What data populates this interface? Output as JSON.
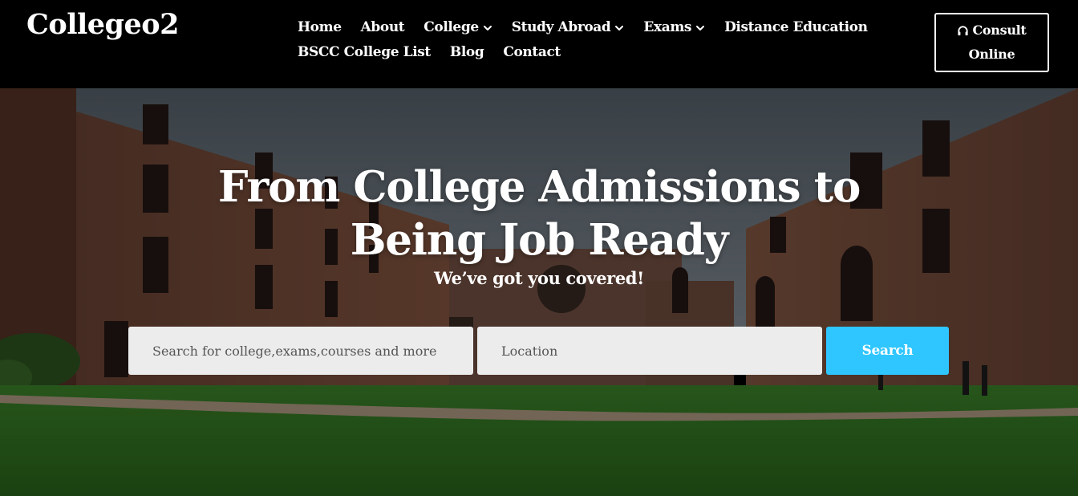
{
  "header": {
    "logo": "Collegeo2",
    "nav_row1": [
      {
        "label": "Home",
        "dropdown": false
      },
      {
        "label": "About",
        "dropdown": false
      },
      {
        "label": "College",
        "dropdown": true
      },
      {
        "label": "Study Abroad",
        "dropdown": true
      },
      {
        "label": "Exams",
        "dropdown": true
      },
      {
        "label": "Distance Education",
        "dropdown": false
      }
    ],
    "nav_row2": [
      {
        "label": "BSCC College List",
        "dropdown": false
      },
      {
        "label": "Blog",
        "dropdown": false
      },
      {
        "label": "Contact",
        "dropdown": false
      }
    ],
    "consult": {
      "line1": "Consult",
      "line2": "Online",
      "icon": "headset-icon"
    }
  },
  "hero": {
    "headline_line1": "From College Admissions to",
    "headline_line2": "Being Job Ready",
    "subline": "We’ve got you covered!",
    "search": {
      "query_placeholder": "Search for college,exams,courses and more",
      "location_placeholder": "Location",
      "button": "Search"
    }
  },
  "colors": {
    "header_bg": "#000000",
    "accent": "#2fc6ff",
    "input_bg": "#ececec"
  }
}
